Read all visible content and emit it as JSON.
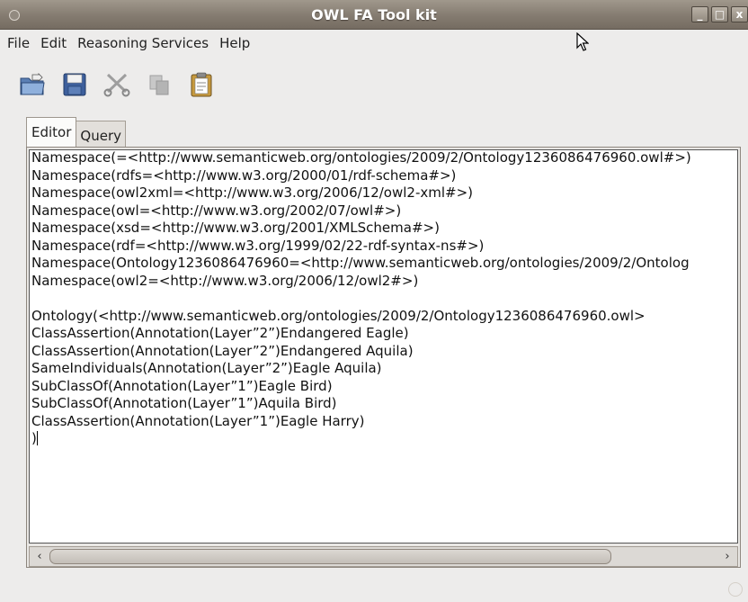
{
  "window": {
    "title": "OWL FA Tool kit",
    "controls": {
      "minimize": "_",
      "maximize": "□",
      "close": "x"
    }
  },
  "menu": {
    "file": "File",
    "edit": "Edit",
    "reasoning": "Reasoning Services",
    "help": "Help"
  },
  "toolbar": {
    "icons": [
      "open-icon",
      "save-icon",
      "cut-icon",
      "copy-icon",
      "paste-icon"
    ]
  },
  "tabs": {
    "editor": "Editor",
    "query": "Query",
    "active": "Editor"
  },
  "editor": {
    "lines": [
      "Namespace(=<http://www.semanticweb.org/ontologies/2009/2/Ontology1236086476960.owl#>)",
      "Namespace(rdfs=<http://www.w3.org/2000/01/rdf-schema#>)",
      "Namespace(owl2xml=<http://www.w3.org/2006/12/owl2-xml#>)",
      "Namespace(owl=<http://www.w3.org/2002/07/owl#>)",
      "Namespace(xsd=<http://www.w3.org/2001/XMLSchema#>)",
      "Namespace(rdf=<http://www.w3.org/1999/02/22-rdf-syntax-ns#>)",
      "Namespace(Ontology1236086476960=<http://www.semanticweb.org/ontologies/2009/2/Ontolog",
      "Namespace(owl2=<http://www.w3.org/2006/12/owl2#>)",
      "",
      "Ontology(<http://www.semanticweb.org/ontologies/2009/2/Ontology1236086476960.owl>",
      "ClassAssertion(Annotation(Layer”2”)Endangered Eagle)",
      "ClassAssertion(Annotation(Layer”2”)Endangered Aquila)",
      "SameIndividuals(Annotation(Layer”2”)Eagle Aquila)",
      "SubClassOf(Annotation(Layer”1”)Eagle Bird)",
      "SubClassOf(Annotation(Layer”1”)Aquila Bird)",
      "ClassAssertion(Annotation(Layer”1”)Eagle Harry)",
      ")"
    ]
  },
  "scrollbar": {
    "left_arrow": "‹",
    "right_arrow": "›"
  },
  "colors": {
    "titlebar": "#847b70",
    "background": "#edeceb",
    "editor_bg": "#ffffff"
  }
}
